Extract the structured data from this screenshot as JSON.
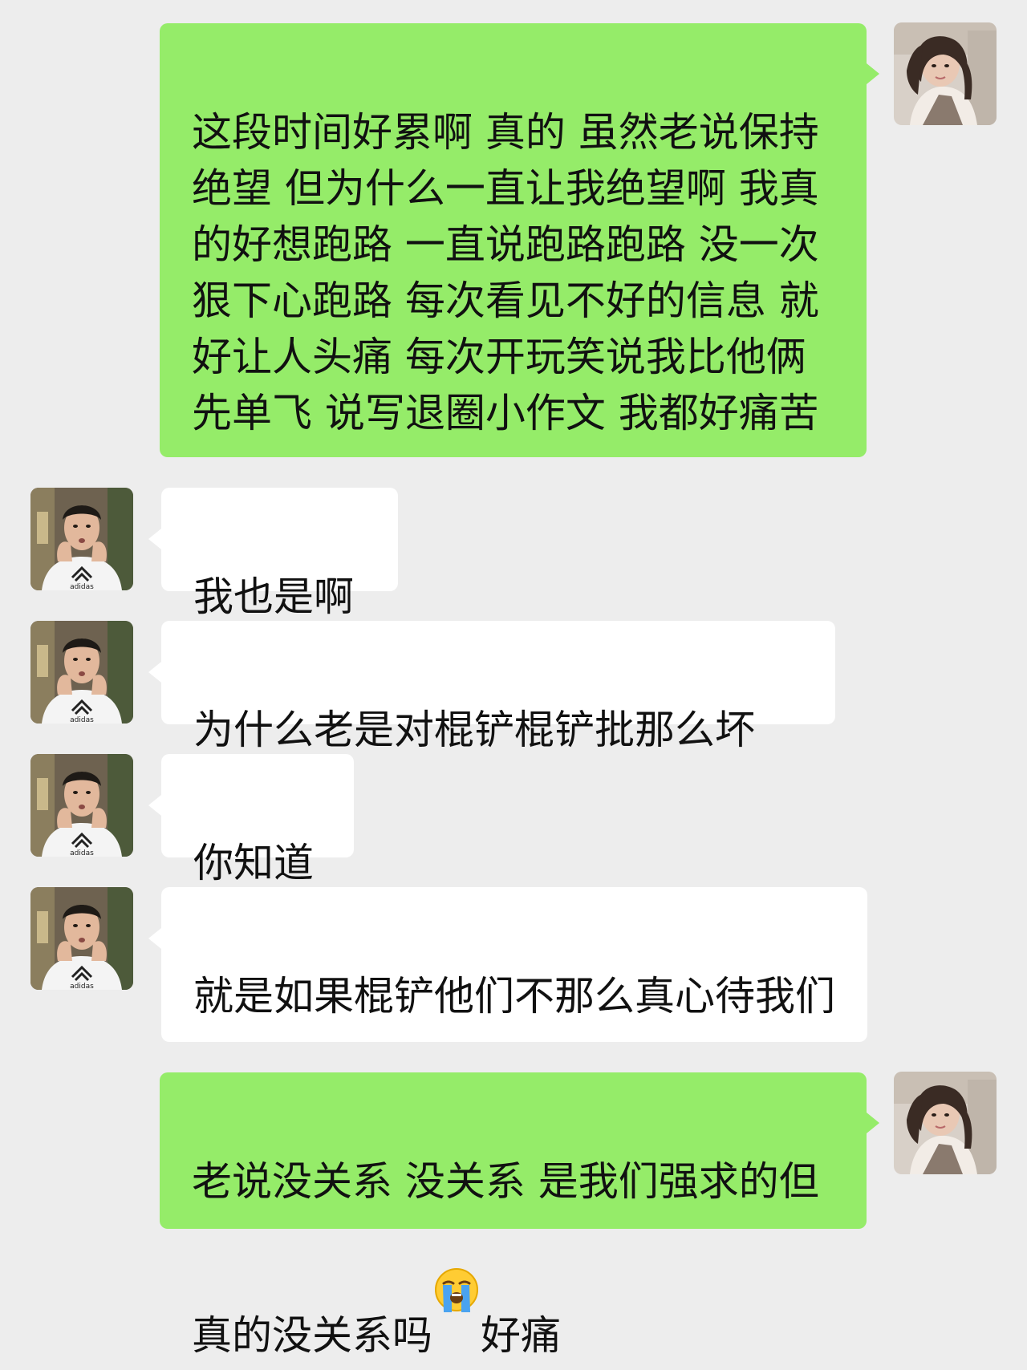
{
  "messages": [
    {
      "sender": "self",
      "text": "这段时间好累啊 真的 虽然老说保持绝望 但为什么一直让我绝望啊 我真的好想跑路 一直说跑路跑路 没一次狠下心跑路 每次看见不好的信息 就好让人头痛 每次开玩笑说我比他俩先单飞 说写退圈小作文 我都好痛苦"
    },
    {
      "sender": "other",
      "text": "我也是啊"
    },
    {
      "sender": "other",
      "text": "为什么老是对棍铲棍铲批那么坏"
    },
    {
      "sender": "other",
      "text": "你知道"
    },
    {
      "sender": "other",
      "text": "就是如果棍铲他们不那么真心待我们"
    },
    {
      "sender": "self",
      "text_before_emoji": "老说没关系 没关系 是我们强求的但真的没关系吗",
      "emoji": "loudly-crying-face",
      "text_after_emoji": "好痛"
    }
  ],
  "colors": {
    "background": "#ededed",
    "outgoing_bubble": "#95ec69",
    "incoming_bubble": "#ffffff"
  }
}
